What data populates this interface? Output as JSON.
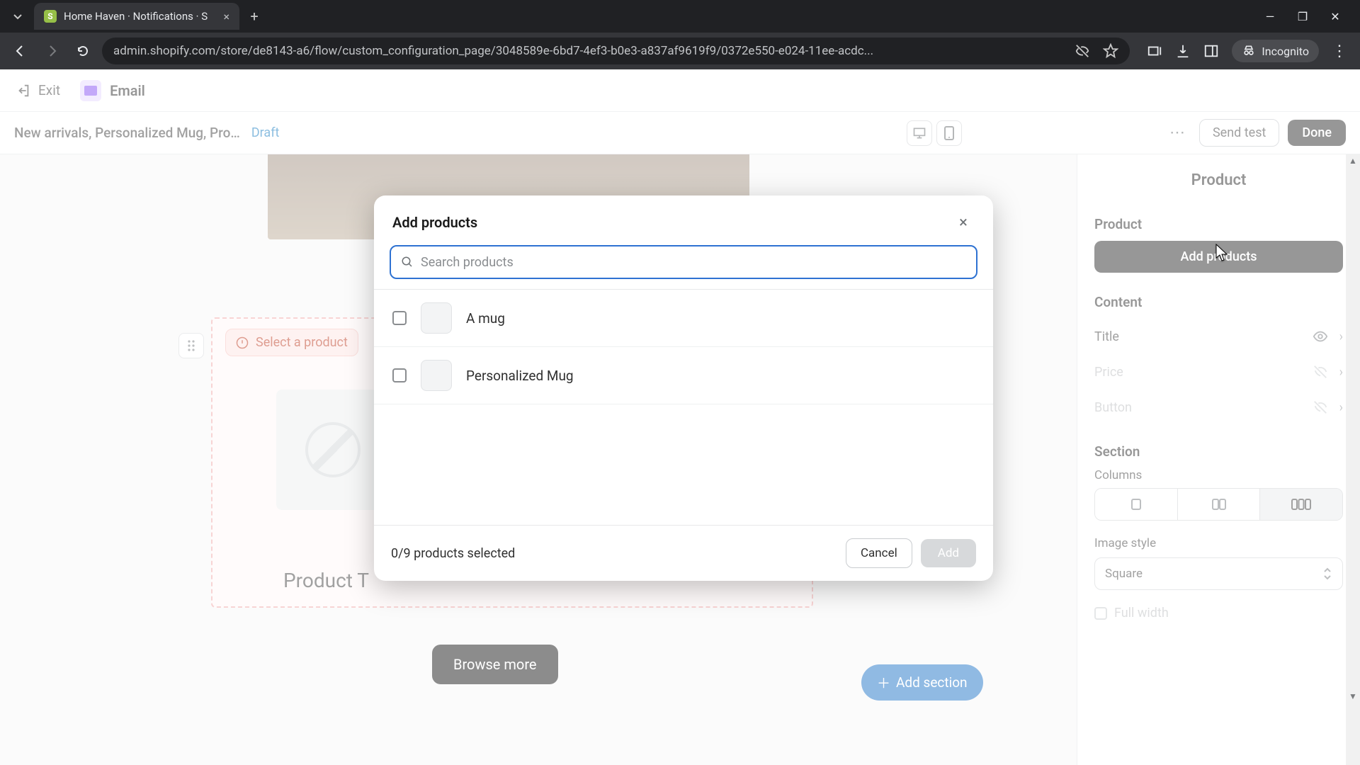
{
  "browser": {
    "tab_title": "Home Haven · Notifications · S",
    "url": "admin.shopify.com/store/de8143-a6/flow/custom_configuration_page/3048589e-6bd7-4ef3-b0e3-a837af9619f9/0372e550-e024-11ee-acdc...",
    "incognito_label": "Incognito"
  },
  "app_topbar": {
    "exit": "Exit",
    "email": "Email"
  },
  "editor_header": {
    "title": "New arrivals, Personalized Mug, Pro…",
    "status": "Draft",
    "send_test": "Send test",
    "done": "Done"
  },
  "canvas": {
    "select_product": "Select a product",
    "product_title": "Product T",
    "browse_more": "Browse more",
    "add_section": "Add section"
  },
  "sidebar": {
    "heading": "Product",
    "product_label": "Product",
    "add_products": "Add products",
    "content_label": "Content",
    "rows": [
      {
        "label": "Title",
        "visible": true
      },
      {
        "label": "Price",
        "visible": false
      },
      {
        "label": "Button",
        "visible": false
      }
    ],
    "section_label": "Section",
    "columns_label": "Columns",
    "image_style_label": "Image style",
    "image_style_value": "Square",
    "full_width": "Full width"
  },
  "modal": {
    "title": "Add products",
    "search_placeholder": "Search products",
    "products": [
      "A mug",
      "Personalized Mug"
    ],
    "selected_count": "0/9 products selected",
    "cancel": "Cancel",
    "add": "Add"
  }
}
